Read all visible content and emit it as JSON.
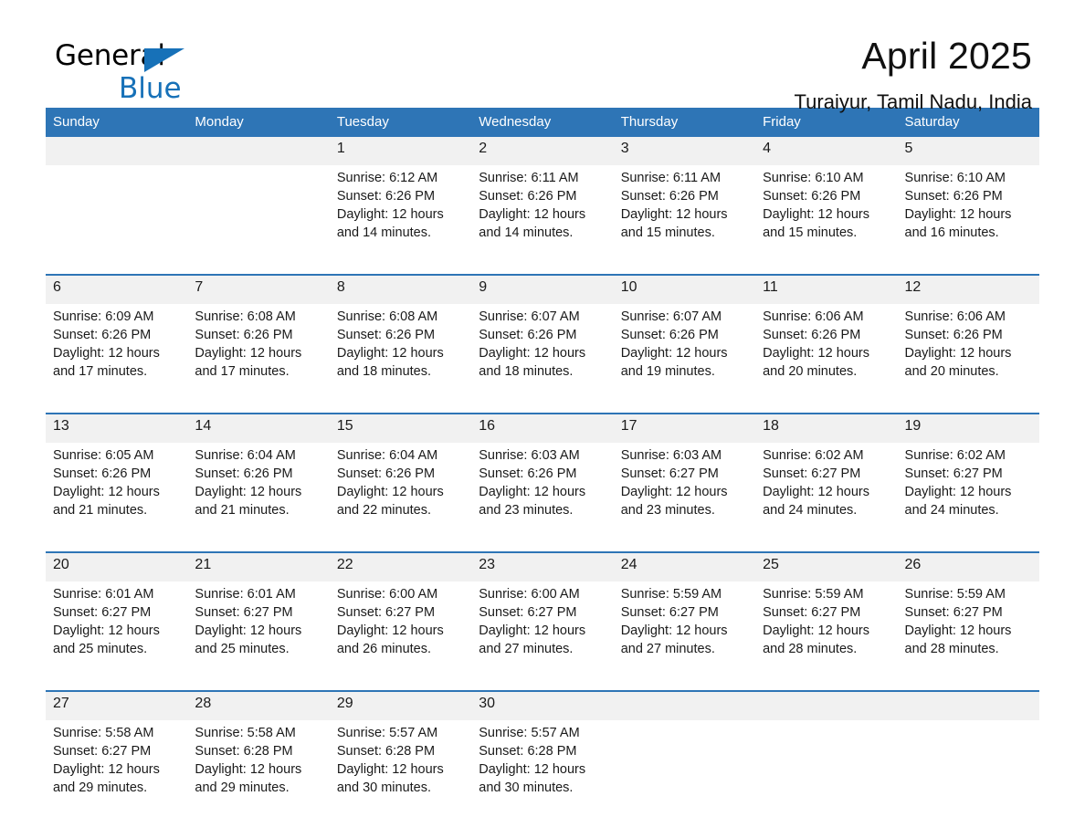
{
  "brand": {
    "line1": "General",
    "line2": "Blue",
    "triangle_color": "#1771b8",
    "logo_icon": "general-blue-logo"
  },
  "header": {
    "month_title": "April 2025",
    "location": "Turaiyur, Tamil Nadu, India"
  },
  "colors": {
    "header_blue": "#2e75b6",
    "daynum_band": "#f1f1f1",
    "cell_bg": "#ffffff",
    "text": "#1a1a1a",
    "brand_blue": "#1771b8"
  },
  "weekdays": [
    "Sunday",
    "Monday",
    "Tuesday",
    "Wednesday",
    "Thursday",
    "Friday",
    "Saturday"
  ],
  "weeks": [
    {
      "days": [
        {
          "num": "",
          "sunrise": "",
          "sunset": "",
          "daylight1": "",
          "daylight2": ""
        },
        {
          "num": "",
          "sunrise": "",
          "sunset": "",
          "daylight1": "",
          "daylight2": ""
        },
        {
          "num": "1",
          "sunrise": "Sunrise: 6:12 AM",
          "sunset": "Sunset: 6:26 PM",
          "daylight1": "Daylight: 12 hours",
          "daylight2": "and 14 minutes."
        },
        {
          "num": "2",
          "sunrise": "Sunrise: 6:11 AM",
          "sunset": "Sunset: 6:26 PM",
          "daylight1": "Daylight: 12 hours",
          "daylight2": "and 14 minutes."
        },
        {
          "num": "3",
          "sunrise": "Sunrise: 6:11 AM",
          "sunset": "Sunset: 6:26 PM",
          "daylight1": "Daylight: 12 hours",
          "daylight2": "and 15 minutes."
        },
        {
          "num": "4",
          "sunrise": "Sunrise: 6:10 AM",
          "sunset": "Sunset: 6:26 PM",
          "daylight1": "Daylight: 12 hours",
          "daylight2": "and 15 minutes."
        },
        {
          "num": "5",
          "sunrise": "Sunrise: 6:10 AM",
          "sunset": "Sunset: 6:26 PM",
          "daylight1": "Daylight: 12 hours",
          "daylight2": "and 16 minutes."
        }
      ]
    },
    {
      "days": [
        {
          "num": "6",
          "sunrise": "Sunrise: 6:09 AM",
          "sunset": "Sunset: 6:26 PM",
          "daylight1": "Daylight: 12 hours",
          "daylight2": "and 17 minutes."
        },
        {
          "num": "7",
          "sunrise": "Sunrise: 6:08 AM",
          "sunset": "Sunset: 6:26 PM",
          "daylight1": "Daylight: 12 hours",
          "daylight2": "and 17 minutes."
        },
        {
          "num": "8",
          "sunrise": "Sunrise: 6:08 AM",
          "sunset": "Sunset: 6:26 PM",
          "daylight1": "Daylight: 12 hours",
          "daylight2": "and 18 minutes."
        },
        {
          "num": "9",
          "sunrise": "Sunrise: 6:07 AM",
          "sunset": "Sunset: 6:26 PM",
          "daylight1": "Daylight: 12 hours",
          "daylight2": "and 18 minutes."
        },
        {
          "num": "10",
          "sunrise": "Sunrise: 6:07 AM",
          "sunset": "Sunset: 6:26 PM",
          "daylight1": "Daylight: 12 hours",
          "daylight2": "and 19 minutes."
        },
        {
          "num": "11",
          "sunrise": "Sunrise: 6:06 AM",
          "sunset": "Sunset: 6:26 PM",
          "daylight1": "Daylight: 12 hours",
          "daylight2": "and 20 minutes."
        },
        {
          "num": "12",
          "sunrise": "Sunrise: 6:06 AM",
          "sunset": "Sunset: 6:26 PM",
          "daylight1": "Daylight: 12 hours",
          "daylight2": "and 20 minutes."
        }
      ]
    },
    {
      "days": [
        {
          "num": "13",
          "sunrise": "Sunrise: 6:05 AM",
          "sunset": "Sunset: 6:26 PM",
          "daylight1": "Daylight: 12 hours",
          "daylight2": "and 21 minutes."
        },
        {
          "num": "14",
          "sunrise": "Sunrise: 6:04 AM",
          "sunset": "Sunset: 6:26 PM",
          "daylight1": "Daylight: 12 hours",
          "daylight2": "and 21 minutes."
        },
        {
          "num": "15",
          "sunrise": "Sunrise: 6:04 AM",
          "sunset": "Sunset: 6:26 PM",
          "daylight1": "Daylight: 12 hours",
          "daylight2": "and 22 minutes."
        },
        {
          "num": "16",
          "sunrise": "Sunrise: 6:03 AM",
          "sunset": "Sunset: 6:26 PM",
          "daylight1": "Daylight: 12 hours",
          "daylight2": "and 23 minutes."
        },
        {
          "num": "17",
          "sunrise": "Sunrise: 6:03 AM",
          "sunset": "Sunset: 6:27 PM",
          "daylight1": "Daylight: 12 hours",
          "daylight2": "and 23 minutes."
        },
        {
          "num": "18",
          "sunrise": "Sunrise: 6:02 AM",
          "sunset": "Sunset: 6:27 PM",
          "daylight1": "Daylight: 12 hours",
          "daylight2": "and 24 minutes."
        },
        {
          "num": "19",
          "sunrise": "Sunrise: 6:02 AM",
          "sunset": "Sunset: 6:27 PM",
          "daylight1": "Daylight: 12 hours",
          "daylight2": "and 24 minutes."
        }
      ]
    },
    {
      "days": [
        {
          "num": "20",
          "sunrise": "Sunrise: 6:01 AM",
          "sunset": "Sunset: 6:27 PM",
          "daylight1": "Daylight: 12 hours",
          "daylight2": "and 25 minutes."
        },
        {
          "num": "21",
          "sunrise": "Sunrise: 6:01 AM",
          "sunset": "Sunset: 6:27 PM",
          "daylight1": "Daylight: 12 hours",
          "daylight2": "and 25 minutes."
        },
        {
          "num": "22",
          "sunrise": "Sunrise: 6:00 AM",
          "sunset": "Sunset: 6:27 PM",
          "daylight1": "Daylight: 12 hours",
          "daylight2": "and 26 minutes."
        },
        {
          "num": "23",
          "sunrise": "Sunrise: 6:00 AM",
          "sunset": "Sunset: 6:27 PM",
          "daylight1": "Daylight: 12 hours",
          "daylight2": "and 27 minutes."
        },
        {
          "num": "24",
          "sunrise": "Sunrise: 5:59 AM",
          "sunset": "Sunset: 6:27 PM",
          "daylight1": "Daylight: 12 hours",
          "daylight2": "and 27 minutes."
        },
        {
          "num": "25",
          "sunrise": "Sunrise: 5:59 AM",
          "sunset": "Sunset: 6:27 PM",
          "daylight1": "Daylight: 12 hours",
          "daylight2": "and 28 minutes."
        },
        {
          "num": "26",
          "sunrise": "Sunrise: 5:59 AM",
          "sunset": "Sunset: 6:27 PM",
          "daylight1": "Daylight: 12 hours",
          "daylight2": "and 28 minutes."
        }
      ]
    },
    {
      "days": [
        {
          "num": "27",
          "sunrise": "Sunrise: 5:58 AM",
          "sunset": "Sunset: 6:27 PM",
          "daylight1": "Daylight: 12 hours",
          "daylight2": "and 29 minutes."
        },
        {
          "num": "28",
          "sunrise": "Sunrise: 5:58 AM",
          "sunset": "Sunset: 6:28 PM",
          "daylight1": "Daylight: 12 hours",
          "daylight2": "and 29 minutes."
        },
        {
          "num": "29",
          "sunrise": "Sunrise: 5:57 AM",
          "sunset": "Sunset: 6:28 PM",
          "daylight1": "Daylight: 12 hours",
          "daylight2": "and 30 minutes."
        },
        {
          "num": "30",
          "sunrise": "Sunrise: 5:57 AM",
          "sunset": "Sunset: 6:28 PM",
          "daylight1": "Daylight: 12 hours",
          "daylight2": "and 30 minutes."
        },
        {
          "num": "",
          "sunrise": "",
          "sunset": "",
          "daylight1": "",
          "daylight2": ""
        },
        {
          "num": "",
          "sunrise": "",
          "sunset": "",
          "daylight1": "",
          "daylight2": ""
        },
        {
          "num": "",
          "sunrise": "",
          "sunset": "",
          "daylight1": "",
          "daylight2": ""
        }
      ]
    }
  ]
}
